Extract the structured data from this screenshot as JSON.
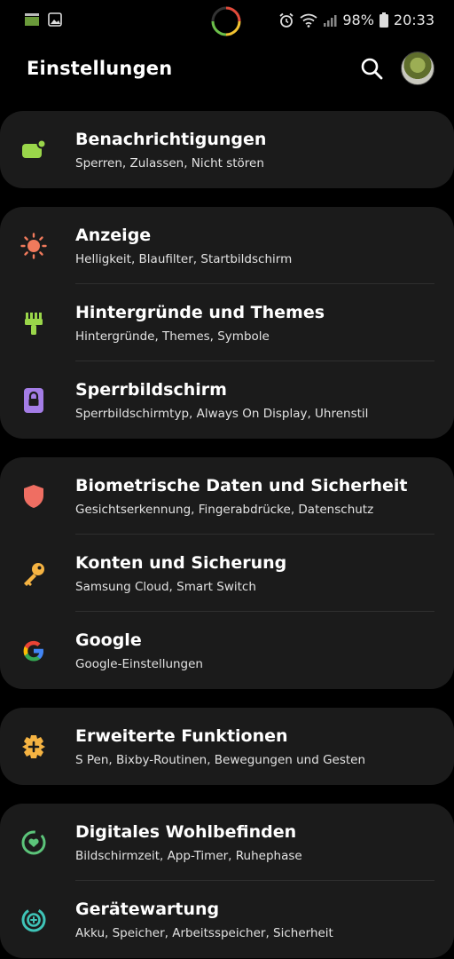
{
  "status_bar": {
    "battery": "98%",
    "time": "20:33",
    "icons": [
      "data-saver-icon",
      "gallery-icon",
      "alarm-icon",
      "wifi-icon",
      "signal-icon",
      "battery-icon"
    ]
  },
  "header": {
    "title": "Einstellungen"
  },
  "groups": [
    {
      "items": [
        {
          "icon": "notification-icon",
          "label": "Benachrichtigungen",
          "sub": "Sperren, Zulassen, Nicht stören",
          "color": "#9ad64a"
        }
      ]
    },
    {
      "items": [
        {
          "icon": "sun-icon",
          "label": "Anzeige",
          "sub": "Helligkeit, Blaufilter, Startbildschirm",
          "color": "#f07a5c"
        },
        {
          "icon": "brush-icon",
          "label": "Hintergründe und Themes",
          "sub": "Hintergründe, Themes, Symbole",
          "color": "#9ad64a"
        },
        {
          "icon": "lock-icon",
          "label": "Sperrbildschirm",
          "sub": "Sperrbildschirmtyp, Always On Display, Uhrenstil",
          "color": "#a47de6"
        }
      ]
    },
    {
      "items": [
        {
          "icon": "shield-icon",
          "label": "Biometrische Daten und Sicherheit",
          "sub": "Gesichtserkennung, Fingerabdrücke, Datenschutz",
          "color": "#ef6e62"
        },
        {
          "icon": "key-icon",
          "label": "Konten und Sicherung",
          "sub": "Samsung Cloud, Smart Switch",
          "color": "#f5b342"
        },
        {
          "icon": "google-icon",
          "label": "Google",
          "sub": "Google-Einstellungen",
          "color": "#4285f4"
        }
      ]
    },
    {
      "items": [
        {
          "icon": "gear-plus-icon",
          "label": "Erweiterte Funktionen",
          "sub": "S Pen, Bixby-Routinen, Bewegungen und Gesten",
          "color": "#f5b342"
        }
      ]
    },
    {
      "items": [
        {
          "icon": "wellbeing-icon",
          "label": "Digitales Wohlbefinden",
          "sub": "Bildschirmzeit, App-Timer, Ruhephase",
          "color": "#5cc47a"
        },
        {
          "icon": "device-care-icon",
          "label": "Gerätewartung",
          "sub": "Akku, Speicher, Arbeitsspeicher, Sicherheit",
          "color": "#3fc4b8"
        }
      ]
    }
  ]
}
